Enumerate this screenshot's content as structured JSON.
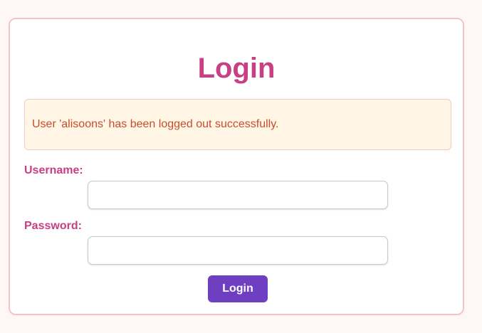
{
  "login": {
    "title": "Login",
    "alert": "User 'alisoons' has been logged out successfully.",
    "username_label": "Username:",
    "username_value": "",
    "password_label": "Password:",
    "password_value": "",
    "submit_label": "Login"
  },
  "colors": {
    "page_bg": "#fff6f6",
    "card_border": "#f3c4c4",
    "title_pink": "#c93f84",
    "alert_bg": "#fff6e5",
    "alert_text": "#cc4b2d",
    "button_purple": "#6e3fc1"
  }
}
